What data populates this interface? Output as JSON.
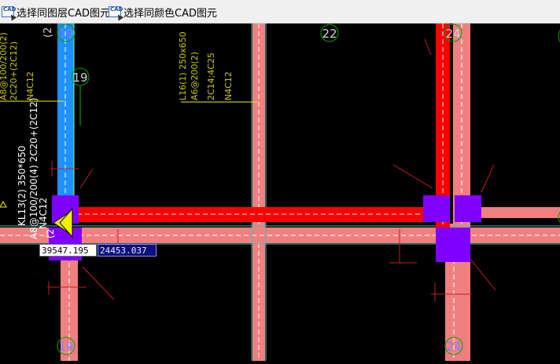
{
  "toolbar": {
    "btn_layer_label": "选择同图层CAD图元",
    "btn_color_label": "选择同颜色CAD图元",
    "icon_text": "CAD"
  },
  "axes": {
    "top_left": "19",
    "top_mid": "22",
    "top_right": "24",
    "mid_left": "19",
    "bottom_left": "19",
    "bottom_right": "24",
    "partial_top": "(2"
  },
  "annotations": {
    "left_top": [
      "A8@100/200(2)",
      "2C20+(2C12)",
      "N4C12"
    ],
    "mid_top": [
      "L16(1) 250x650",
      "A6@200(2)",
      "2C14;4C25",
      "N4C12"
    ],
    "beam_main": "KL13(2) 350*650",
    "beam_stirrup": "A8@100/200(4) 2C20+(2C12)",
    "beam_extra1": "N4C12",
    "beam_extra2": "(2"
  },
  "coords": {
    "x": "39547.195",
    "y": "24453.037"
  },
  "colors": {
    "beam_red": "#ff0000",
    "beam_pink": "#f08080",
    "column_purple": "#8000ff",
    "selected_blue": "#1e90ff",
    "text_yellow": "#c8c800",
    "axis_green": "#00a000"
  }
}
